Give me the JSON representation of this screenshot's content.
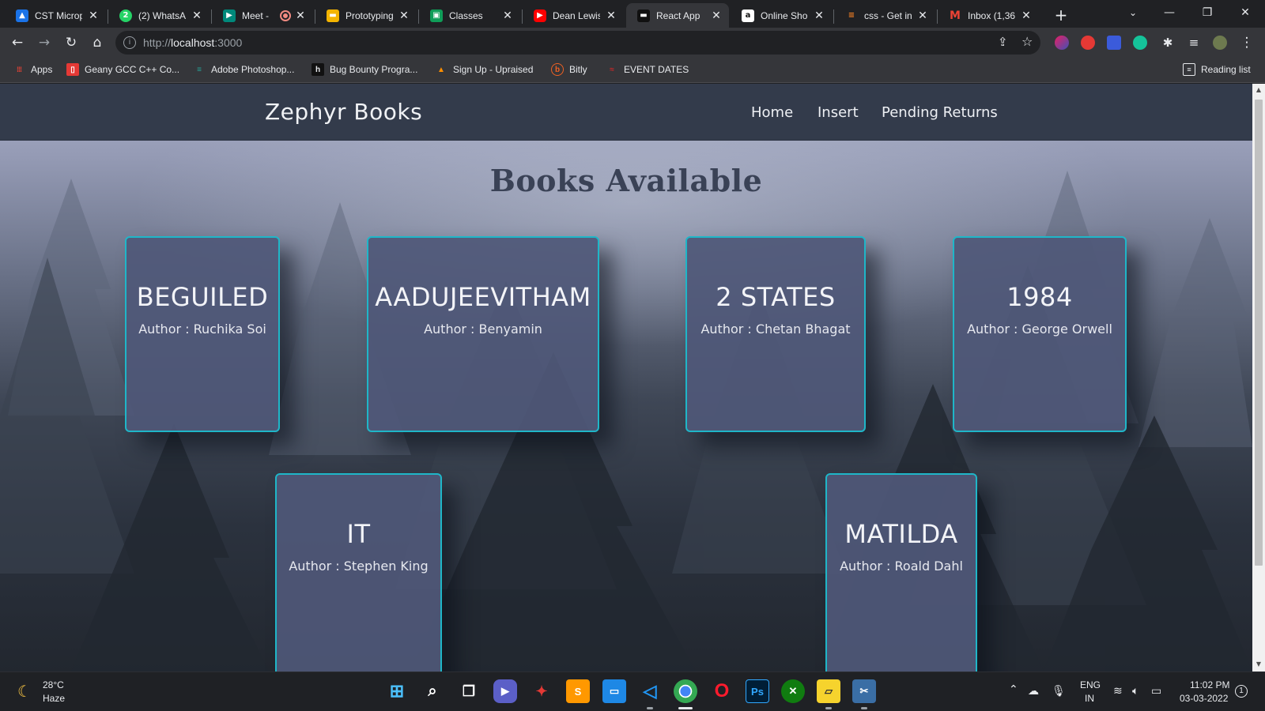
{
  "browser": {
    "tabs": [
      {
        "title": "CST Microp",
        "active": false,
        "color": "#1a73e8",
        "glyph": "▲"
      },
      {
        "title": "(2) WhatsAp",
        "active": false,
        "color": "#25d366",
        "glyph": "2"
      },
      {
        "title": "Meet -",
        "active": false,
        "color": "#00897b",
        "glyph": "▶"
      },
      {
        "title": "Prototyping",
        "active": false,
        "color": "#f4b400",
        "glyph": "▬"
      },
      {
        "title": "Classes",
        "active": false,
        "color": "#0f9d58",
        "glyph": "▣"
      },
      {
        "title": "Dean Lewis",
        "active": false,
        "color": "#ff0000",
        "glyph": "▶"
      },
      {
        "title": "React App",
        "active": true,
        "color": "#222222",
        "glyph": "▬"
      },
      {
        "title": "Online Shop",
        "active": false,
        "color": "#ffffff",
        "glyph": "a"
      },
      {
        "title": "css - Get in",
        "active": false,
        "color": "#f48024",
        "glyph": "≡"
      },
      {
        "title": "Inbox (1,36",
        "active": false,
        "color": "#ea4335",
        "glyph": "M"
      }
    ],
    "url_scheme": "http://",
    "url_host": "localhost",
    "url_port": ":3000",
    "bookmarks": [
      {
        "label": "Apps",
        "color": "#ea4335",
        "glyph": "⋮⋮"
      },
      {
        "label": "Geany GCC C++ Co...",
        "color": "#e53935",
        "glyph": "▯"
      },
      {
        "label": "Adobe Photoshop...",
        "color": "#26a69a",
        "glyph": "≡"
      },
      {
        "label": "Bug Bounty Progra...",
        "color": "#111111",
        "glyph": "h"
      },
      {
        "label": "Sign Up - Upraised",
        "color": "#ff8f00",
        "glyph": "▲"
      },
      {
        "label": "Bitly",
        "color": "#ee6123",
        "glyph": "b"
      },
      {
        "label": "EVENT DATES",
        "color": "#c62828",
        "glyph": "≈"
      }
    ],
    "reading_list": "Reading list"
  },
  "app": {
    "brand": "Zephyr Books",
    "nav": [
      "Home",
      "Insert",
      "Pending Returns"
    ],
    "heading": "Books Available",
    "books": [
      {
        "title": "BEGUILED",
        "author": "Author : Ruchika Soi"
      },
      {
        "title": "AADUJEEVITHAM",
        "author": "Author : Benyamin"
      },
      {
        "title": "2 STATES",
        "author": "Author : Chetan Bhagat"
      },
      {
        "title": "1984",
        "author": "Author : George Orwell"
      },
      {
        "title": "IT",
        "author": "Author : Stephen King"
      },
      {
        "title": "MATILDA",
        "author": "Author : Roald Dahl"
      }
    ]
  },
  "taskbar": {
    "weather_temp": "28°C",
    "weather_desc": "Haze",
    "lang_top": "ENG",
    "lang_bottom": "IN",
    "time": "11:02 PM",
    "date": "03-03-2022",
    "notifications": "1"
  }
}
